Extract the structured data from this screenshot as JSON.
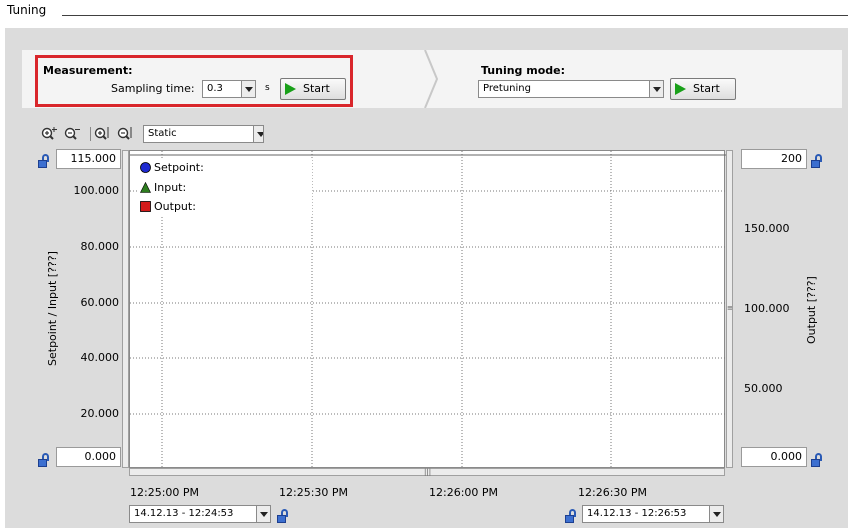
{
  "window": {
    "title": "Tuning"
  },
  "measurement": {
    "heading": "Measurement:",
    "sampling_label": "Sampling time:",
    "sampling_value": "0.3",
    "unit": "s",
    "start_label": "Start"
  },
  "tuning": {
    "heading": "Tuning mode:",
    "mode_value": "Pretuning",
    "start_label": "Start"
  },
  "view": {
    "mode_value": "Static"
  },
  "axes": {
    "left": {
      "max": "115.000",
      "min": "0.000",
      "label": "Setpoint / Input   [???]",
      "ticks": [
        "100.000",
        "80.000",
        "60.000",
        "40.000",
        "20.000"
      ]
    },
    "right": {
      "max": "200",
      "min": "0.000",
      "label": "Output   [???]",
      "ticks": [
        "150.000",
        "100.000",
        "50.000"
      ]
    },
    "x": {
      "ticks": [
        "12:25:00 PM",
        "12:25:30 PM",
        "12:26:00 PM",
        "12:26:30 PM"
      ],
      "start": "14.12.13 - 12:24:53",
      "end": "14.12.13 - 12:26:53"
    }
  },
  "legend": [
    {
      "label": "Setpoint:",
      "color": "#1f2bd1",
      "shape": "circle"
    },
    {
      "label": "Input:",
      "color": "#2e7d1f",
      "shape": "triangle"
    },
    {
      "label": "Output:",
      "color": "#d21b1b",
      "shape": "square"
    }
  ],
  "icons": [
    "zoom-in-icon",
    "zoom-out-icon",
    "zoom-fit-icon",
    "zoom-reset-icon",
    "lock-icon"
  ],
  "colors": {
    "highlight": "#d9262b",
    "play": "#19a019",
    "lock": "#3c6fd0"
  }
}
